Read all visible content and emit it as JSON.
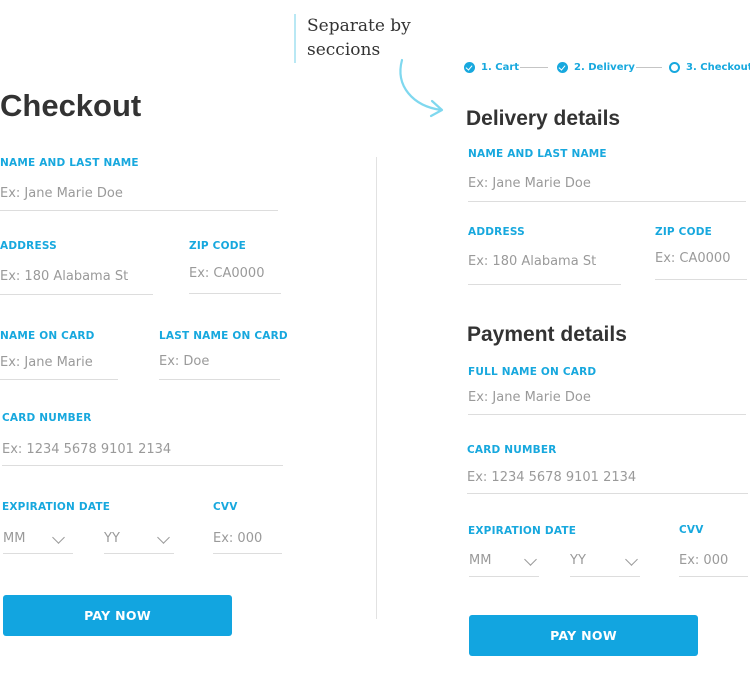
{
  "annotation": {
    "line1": "Separate by",
    "line2": "seccions"
  },
  "steps": [
    {
      "label": "1. Cart",
      "state": "done"
    },
    {
      "label": "2. Delivery",
      "state": "done"
    },
    {
      "label": "3. Checkout",
      "state": "current"
    }
  ],
  "left": {
    "title": "Checkout",
    "name_label": "NAME AND LAST NAME",
    "name_placeholder": "Ex: Jane Marie Doe",
    "address_label": "ADDRESS",
    "address_placeholder": "Ex: 180 Alabama St",
    "zip_label": "ZIP CODE",
    "zip_placeholder": "Ex: CA0000",
    "card_name_label": "NAME ON CARD",
    "card_name_placeholder": "Ex: Jane Marie",
    "card_last_label": "LAST NAME ON CARD",
    "card_last_placeholder": "Ex: Doe",
    "card_number_label": "CARD NUMBER",
    "card_number_placeholder": "Ex: 1234 5678 9101 2134",
    "expiration_label": "EXPIRATION DATE",
    "month_value": "MM",
    "year_value": "YY",
    "cvv_label": "CVV",
    "cvv_placeholder": "Ex: 000",
    "pay_button": "PAY NOW"
  },
  "right": {
    "delivery_title": "Delivery details",
    "name_label": "NAME AND LAST NAME",
    "name_placeholder": "Ex: Jane Marie Doe",
    "address_label": "ADDRESS",
    "address_placeholder": "Ex: 180 Alabama St",
    "zip_label": "ZIP CODE",
    "zip_placeholder": "Ex: CA0000",
    "payment_title": "Payment details",
    "full_name_label": "FULL NAME ON CARD",
    "full_name_placeholder": "Ex: Jane Marie Doe",
    "card_number_label": "CARD NUMBER",
    "card_number_placeholder": "Ex: 1234 5678 9101 2134",
    "expiration_label": "EXPIRATION DATE",
    "month_value": "MM",
    "year_value": "YY",
    "cvv_label": "CVV",
    "cvv_placeholder": "Ex: 000",
    "pay_button": "PAY NOW"
  },
  "colors": {
    "accent": "#12a5e0",
    "label": "#17a8de",
    "annotation": "#7fd8ef"
  }
}
